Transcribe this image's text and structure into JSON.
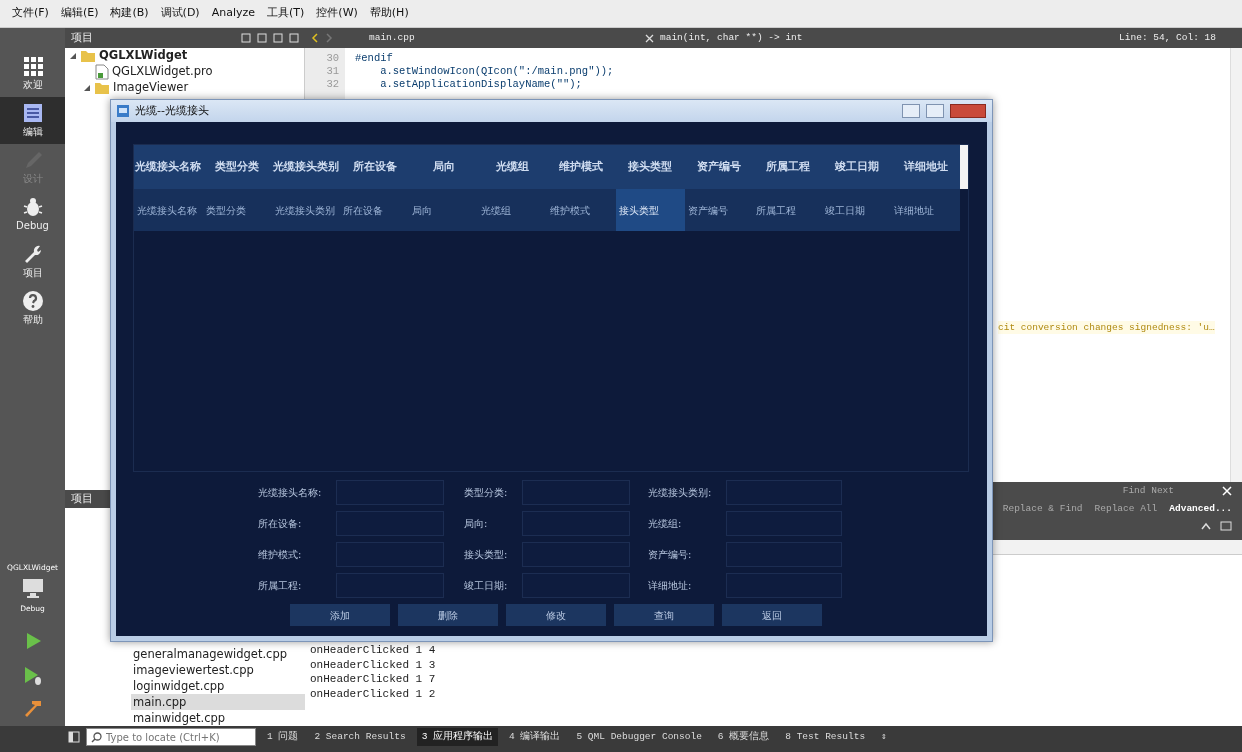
{
  "menu": [
    "文件(F)",
    "编辑(E)",
    "构建(B)",
    "调试(D)",
    "Analyze",
    "工具(T)",
    "控件(W)",
    "帮助(H)"
  ],
  "mode_bar": {
    "items": [
      {
        "label": "欢迎",
        "kind": "welcome",
        "selected": false,
        "disabled": false
      },
      {
        "label": "编辑",
        "kind": "edit",
        "selected": true,
        "disabled": false
      },
      {
        "label": "设计",
        "kind": "design",
        "selected": false,
        "disabled": true
      },
      {
        "label": "Debug",
        "kind": "debug",
        "selected": false,
        "disabled": false
      },
      {
        "label": "项目",
        "kind": "projects",
        "selected": false,
        "disabled": false
      },
      {
        "label": "帮助",
        "kind": "help",
        "selected": false,
        "disabled": false
      }
    ],
    "target": {
      "project": "QGLXLWidget",
      "config": "Debug"
    },
    "actions": [
      {
        "kind": "run"
      },
      {
        "kind": "debug-run"
      },
      {
        "kind": "build"
      }
    ]
  },
  "project_pane": {
    "title": "项目",
    "tree": [
      {
        "label": "QGLXLWidget",
        "kind": "project",
        "expanded": true,
        "children": [
          {
            "label": "QGLXLWidget.pro",
            "kind": "file"
          },
          {
            "label": "ImageViewer",
            "kind": "folder",
            "expanded": true
          }
        ]
      }
    ]
  },
  "editor": {
    "file_tab": "main.cpp",
    "function": "main(int, char **) -> int",
    "position": "Line: 54, Col: 18",
    "lines": [
      {
        "number": "30",
        "text": "#endif"
      },
      {
        "number": "31",
        "text": "    a.setWindowIcon(QIcon(\":/main.png\"));"
      },
      {
        "number": "32",
        "text": "    a.setApplicationDisplayName(\"\");"
      }
    ],
    "warning": "cit conversion changes signedness: 'u…"
  },
  "find_bar": {
    "find_next": "Find Next",
    "buttons": [
      "Replace & Find",
      "Replace All",
      "Advanced..."
    ]
  },
  "lower_pane": {
    "title": "项目",
    "files": [
      {
        "name": "generalmanagewidget.cpp",
        "selected": false
      },
      {
        "name": "imageviewertest.cpp",
        "selected": false
      },
      {
        "name": "loginwidget.cpp",
        "selected": false
      },
      {
        "name": "main.cpp",
        "selected": true
      },
      {
        "name": "mainwidget.cpp",
        "selected": false
      }
    ]
  },
  "output": {
    "lines": [
      "onHeaderClicked 1 4",
      "onHeaderClicked 1 3",
      "onHeaderClicked 1 7",
      "onHeaderClicked 1 2"
    ]
  },
  "status_bar": {
    "locate_placeholder": "Type to locate (Ctrl+K)",
    "tabs": [
      {
        "label": "1 问题",
        "selected": false
      },
      {
        "label": "2 Search Results",
        "selected": false
      },
      {
        "label": "3 应用程序输出",
        "selected": true
      },
      {
        "label": "4 编译输出",
        "selected": false
      },
      {
        "label": "5 QML Debugger Console",
        "selected": false
      },
      {
        "label": "6 概要信息",
        "selected": false
      },
      {
        "label": "8 Test Results",
        "selected": false
      }
    ],
    "toggle": "⇕"
  },
  "dialog": {
    "title": "光缆--光缆接头",
    "table": {
      "columns": [
        "光缆接头名称",
        "类型分类",
        "光缆接头类别",
        "所在设备",
        "局向",
        "光缆组",
        "维护模式",
        "接头类型",
        "资产编号",
        "所属工程",
        "竣工日期",
        "详细地址"
      ],
      "rows": [
        {
          "cells": [
            {
              "text": "光缆接头名称",
              "selected": false
            },
            {
              "text": "类型分类",
              "selected": false
            },
            {
              "text": "光缆接头类别",
              "selected": false
            },
            {
              "text": "所在设备",
              "selected": false
            },
            {
              "text": "局向",
              "selected": false
            },
            {
              "text": "光缆组",
              "selected": false
            },
            {
              "text": "维护模式",
              "selected": false
            },
            {
              "text": "接头类型",
              "selected": true
            },
            {
              "text": "资产编号",
              "selected": false
            },
            {
              "text": "所属工程",
              "selected": false
            },
            {
              "text": "竣工日期",
              "selected": false
            },
            {
              "text": "详细地址",
              "selected": false
            }
          ]
        }
      ]
    },
    "form": [
      {
        "label": "光缆接头名称:"
      },
      {
        "label": "类型分类:"
      },
      {
        "label": "光缆接头类别:"
      },
      {
        "label": "所在设备:"
      },
      {
        "label": "局向:"
      },
      {
        "label": "光缆组:"
      },
      {
        "label": "维护模式:"
      },
      {
        "label": "接头类型:"
      },
      {
        "label": "资产编号:"
      },
      {
        "label": "所属工程:"
      },
      {
        "label": "竣工日期:"
      },
      {
        "label": "详细地址:"
      }
    ],
    "buttons": [
      "添加",
      "删除",
      "修改",
      "查询",
      "返回"
    ]
  }
}
